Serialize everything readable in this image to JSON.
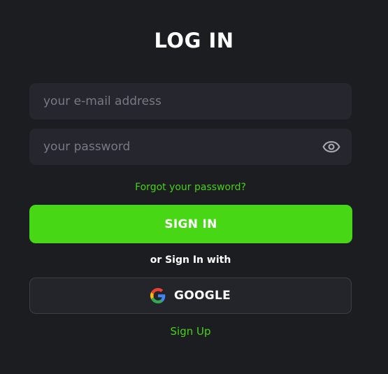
{
  "login": {
    "title": "LOG IN",
    "email_placeholder": "your e-mail address",
    "email_value": "",
    "password_placeholder": "your password",
    "password_value": "",
    "forgot_label": "Forgot your password?",
    "signin_label": "SIGN IN",
    "or_label": "or Sign In with",
    "google_label": "GOOGLE",
    "signup_label": "Sign Up"
  },
  "icons": {
    "password_toggle": "eye-icon",
    "google": "google-logo-icon"
  },
  "colors": {
    "background": "#1c1d21",
    "input_bg": "#26272e",
    "accent": "#47d715",
    "link": "#47d117",
    "text": "#ffffff",
    "placeholder": "#777983"
  }
}
